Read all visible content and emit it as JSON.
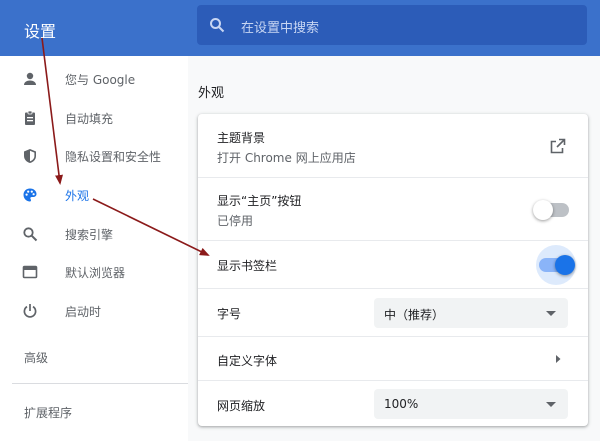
{
  "header": {
    "title": "设置",
    "search_placeholder": "在设置中搜索"
  },
  "sidebar": {
    "items": [
      {
        "label": "您与 Google",
        "icon": "person-icon"
      },
      {
        "label": "自动填充",
        "icon": "clipboard-icon"
      },
      {
        "label": "隐私设置和安全性",
        "icon": "shield-icon"
      },
      {
        "label": "外观",
        "icon": "palette-icon",
        "active": true
      },
      {
        "label": "搜索引擎",
        "icon": "search-icon"
      },
      {
        "label": "默认浏览器",
        "icon": "browser-icon"
      },
      {
        "label": "启动时",
        "icon": "power-icon"
      }
    ],
    "advanced": "高级",
    "extensions": "扩展程序"
  },
  "section": {
    "title": "外观"
  },
  "settings": {
    "theme": {
      "label": "主题背景",
      "sub": "打开 Chrome 网上应用店"
    },
    "home_button": {
      "label": "显示“主页”按钮",
      "sub": "已停用",
      "enabled": false
    },
    "bookmarks_bar": {
      "label": "显示书签栏",
      "enabled": true
    },
    "font_size": {
      "label": "字号",
      "value": "中（推荐）"
    },
    "custom_fonts": {
      "label": "自定义字体"
    },
    "page_zoom": {
      "label": "网页缩放",
      "value": "100%"
    }
  },
  "colors": {
    "header": "#3b71cb",
    "accent": "#1a73e8",
    "annotation_arrow": "#8b1a1a"
  }
}
